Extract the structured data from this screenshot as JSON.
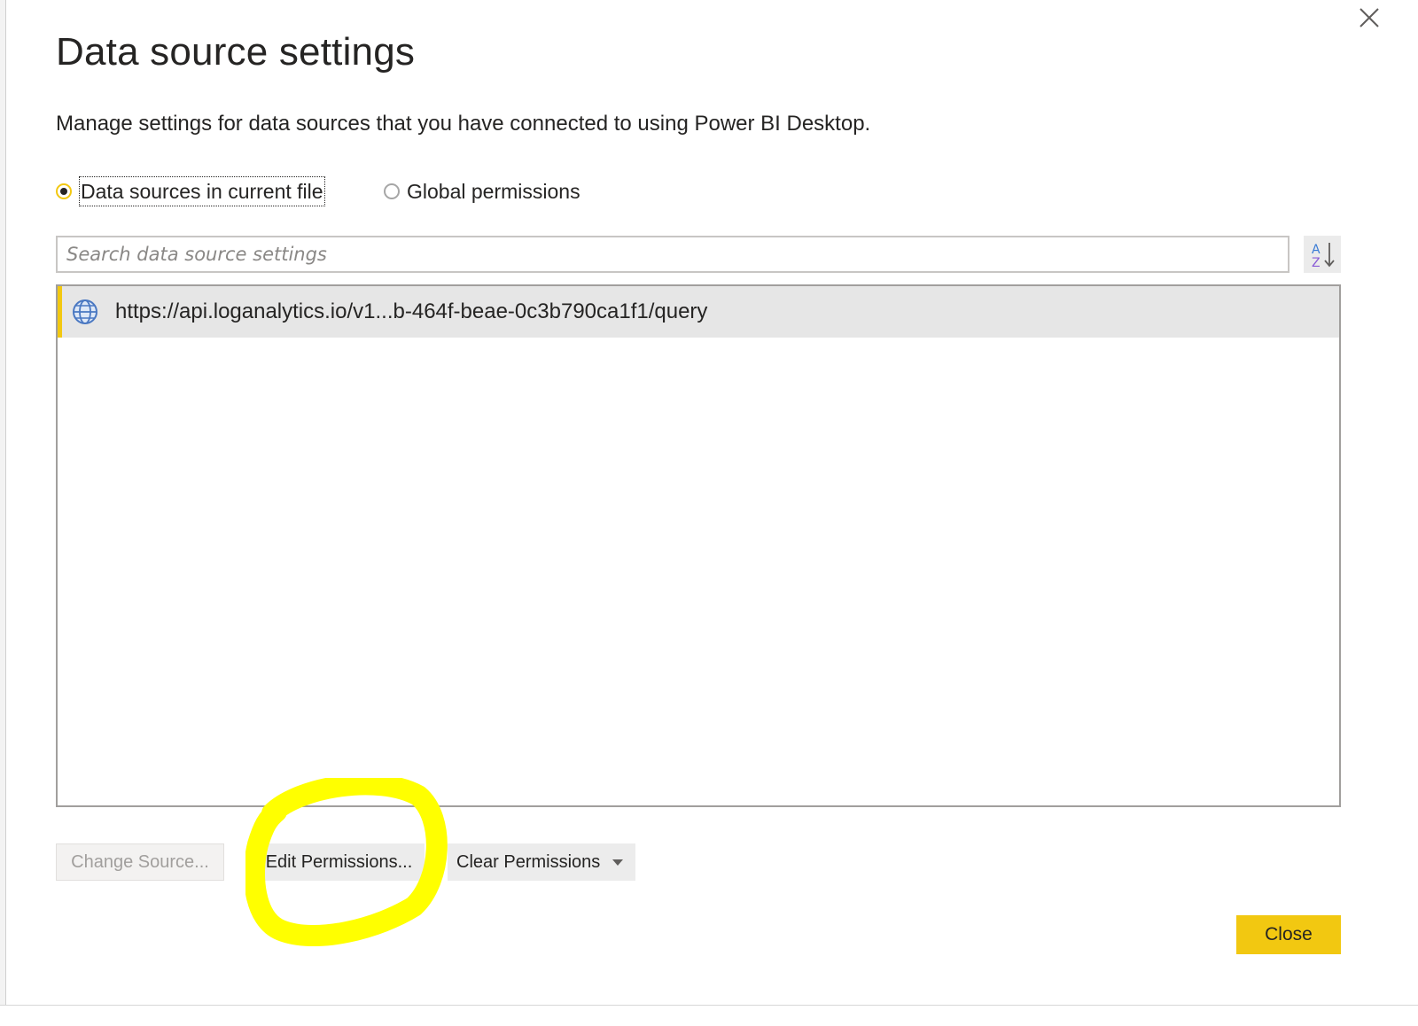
{
  "dialog": {
    "title": "Data source settings",
    "subtitle": "Manage settings for data sources that you have connected to using Power BI Desktop.",
    "close_icon": "close-icon"
  },
  "scope": {
    "options": [
      {
        "label": "Data sources in current file",
        "selected": true
      },
      {
        "label": "Global permissions",
        "selected": false
      }
    ]
  },
  "search": {
    "placeholder": "Search data source settings",
    "value": ""
  },
  "sort": {
    "icon": "sort-az-icon",
    "label_top": "A",
    "label_bottom": "Z"
  },
  "sources": [
    {
      "icon": "globe-icon",
      "url": "https://api.loganalytics.io/v1...b-464f-beae-0c3b790ca1f1/query",
      "selected": true
    }
  ],
  "actions": {
    "change_source": "Change Source...",
    "edit_permissions": "Edit Permissions...",
    "clear_permissions": "Clear Permissions",
    "close": "Close"
  },
  "colors": {
    "accent": "#F2C811",
    "highlight": "#FFFF00",
    "text": "#252423",
    "disabled_text": "#A19F9D"
  }
}
